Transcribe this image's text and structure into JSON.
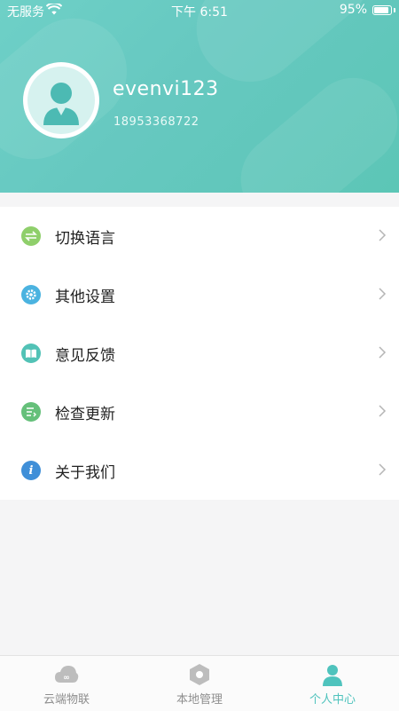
{
  "status": {
    "carrier": "无服务",
    "time": "下午 6:51",
    "battery": "95%"
  },
  "profile": {
    "username": "evenvi123",
    "phone": "18953368722"
  },
  "menu": [
    {
      "label": "切换语言",
      "icon": "swap-icon",
      "color": "#8fcf6b"
    },
    {
      "label": "其他设置",
      "icon": "gear-icon",
      "color": "#4bb3e0"
    },
    {
      "label": "意见反馈",
      "icon": "book-icon",
      "color": "#52c2b6"
    },
    {
      "label": "检查更新",
      "icon": "list-icon",
      "color": "#65c07a"
    },
    {
      "label": "关于我们",
      "icon": "info-icon",
      "color": "#3f8fd8"
    }
  ],
  "tabs": [
    {
      "label": "云端物联",
      "icon": "cloud-icon",
      "active": false
    },
    {
      "label": "本地管理",
      "icon": "hexagon-icon",
      "active": false
    },
    {
      "label": "个人中心",
      "icon": "person-icon",
      "active": true
    }
  ],
  "colors": {
    "accent": "#4fc3bd",
    "header": "#66c8c0"
  }
}
